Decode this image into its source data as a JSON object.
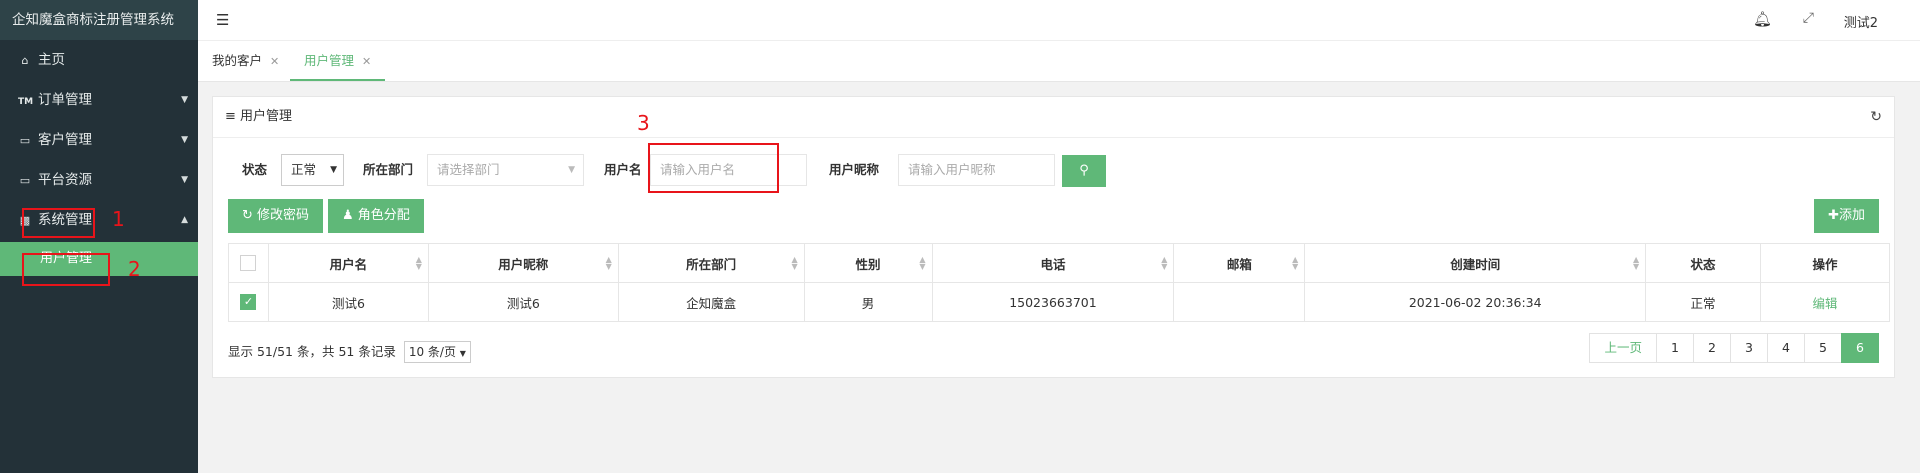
{
  "app_title": "企知魔盒商标注册管理系统",
  "sidebar": {
    "items": [
      {
        "icon": "home-icon",
        "label": "主页"
      },
      {
        "icon": "tm-icon",
        "label": "订单管理"
      },
      {
        "icon": "monitor-icon",
        "label": "客户管理"
      },
      {
        "icon": "monitor-icon",
        "label": "平台资源"
      },
      {
        "icon": "settings-icon",
        "label": "系统管理"
      }
    ],
    "tm_badge": "TM",
    "sub_item": "用户管理"
  },
  "topbar": {
    "user": "测试2"
  },
  "tabs": [
    {
      "label": "我的客户",
      "active": false
    },
    {
      "label": "用户管理",
      "active": true
    }
  ],
  "panel": {
    "title": "用户管理",
    "filters": {
      "status_label": "状态",
      "status_value": "正常",
      "dept_label": "所在部门",
      "dept_placeholder": "请选择部门",
      "username_label": "用户名",
      "username_placeholder": "请输入用户名",
      "nickname_label": "用户昵称",
      "nickname_placeholder": "请输入用户昵称"
    },
    "buttons": {
      "change_pwd": "修改密码",
      "assign_role": "角色分配",
      "add": "添加"
    },
    "table": {
      "headers": [
        "用户名",
        "用户昵称",
        "所在部门",
        "性别",
        "电话",
        "邮箱",
        "创建时间",
        "状态",
        "操作"
      ],
      "rows": [
        {
          "username": "测试6",
          "nickname": "测试6",
          "dept": "企知魔盒",
          "gender": "男",
          "phone": "15023663701",
          "email": "",
          "created": "2021-06-02 20:36:34",
          "status": "正常",
          "action": "编辑",
          "checked": true
        }
      ]
    },
    "pager": {
      "info": "显示 51/51 条，共 51 条记录",
      "page_size": "10 条/页",
      "prev": "上一页",
      "pages": [
        "1",
        "2",
        "3",
        "4",
        "5",
        "6"
      ],
      "current": "6"
    }
  },
  "annotations": [
    "1",
    "2",
    "3"
  ],
  "colors": {
    "accent": "#5fb878",
    "sidebar_bg": "#233138",
    "annotation": "#e8141a"
  }
}
